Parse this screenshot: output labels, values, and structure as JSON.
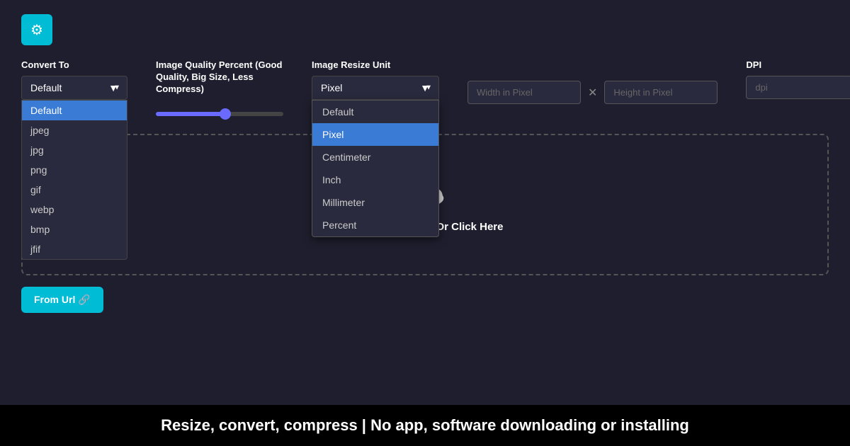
{
  "gear": {
    "icon": "⚙"
  },
  "convert_to": {
    "label": "Convert To",
    "selected": "Default",
    "options": [
      "Default",
      "jpeg",
      "jpg",
      "png",
      "gif",
      "webp",
      "bmp",
      "jfif"
    ]
  },
  "quality": {
    "label": "Image Quality Percent (Good Quality, Big Size, Less Compress)",
    "value": 55
  },
  "resize_unit": {
    "label": "Image Resize Unit",
    "selected": "Pixel",
    "options": [
      "Default",
      "Pixel",
      "Centimeter",
      "Inch",
      "Millimeter",
      "Percent"
    ]
  },
  "width_input": {
    "placeholder": "Width in Pixel"
  },
  "height_input": {
    "placeholder": "Height in Pixel"
  },
  "dpi": {
    "label": "DPI",
    "placeholder": "dpi"
  },
  "drop_zone": {
    "text": "☛ Drag and Drop Or Click Here"
  },
  "from_url": {
    "label": "From Url 🔗"
  },
  "footer": {
    "text": "Resize, convert, compress | No app, software downloading or installing"
  }
}
